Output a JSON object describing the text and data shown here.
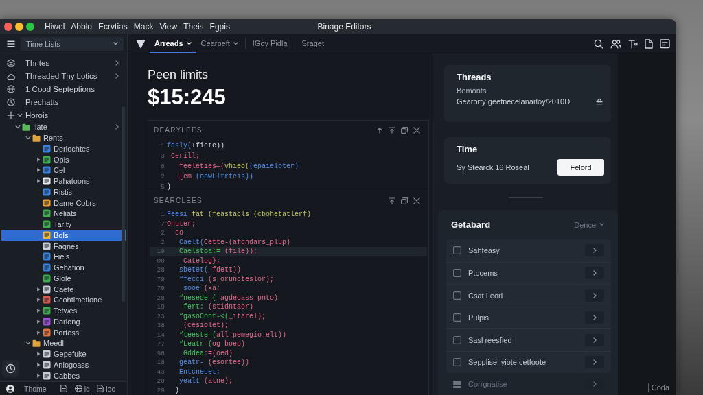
{
  "window": {
    "title": "Binage Editors",
    "menu": [
      "Hiwel",
      "Abblo",
      "Ecrvtias",
      "Mack",
      "View",
      "Theis",
      "Fgpis"
    ]
  },
  "sidebar": {
    "select": {
      "value": "Time Lists"
    },
    "tree": [
      {
        "label": "Thrites",
        "kind": "link",
        "selected": false
      },
      {
        "label": "Threaded Thy Lotics",
        "kind": "link",
        "selected": false
      },
      {
        "label": "1 Cood Septeptions",
        "kind": "item",
        "selected": false
      },
      {
        "label": "Prechatts",
        "kind": "item",
        "selected": false
      },
      {
        "label": "Horois",
        "kind": "item",
        "selected": false,
        "expanded": true,
        "children": [
          {
            "label": "Ilate",
            "kind": "link",
            "selected": false,
            "expanded": true,
            "color": "#5cb85c",
            "children": [
              {
                "label": "Rents",
                "selected": false,
                "expanded": true,
                "color": "#e0a33a",
                "children": [
                  {
                    "label": "Deriochtes",
                    "selected": false,
                    "color": "#3b82e0"
                  },
                  {
                    "label": "Opls",
                    "selected": false,
                    "expanded": false,
                    "color": "#3daa4e"
                  },
                  {
                    "label": "Cel",
                    "selected": false,
                    "expanded": false,
                    "color": "#3b82e0"
                  },
                  {
                    "label": "Pahatoons",
                    "selected": false,
                    "expanded": false,
                    "color": "#e4e6ea"
                  },
                  {
                    "label": "Ristis",
                    "selected": false,
                    "color": "#3b82e0"
                  },
                  {
                    "label": "Dame Cobrs",
                    "selected": false,
                    "color": "#e09a35"
                  },
                  {
                    "label": "Neliats",
                    "selected": false,
                    "color": "#3daa4e"
                  },
                  {
                    "label": "Tarity",
                    "selected": false,
                    "color": "#3daa4e"
                  },
                  {
                    "label": "Bols",
                    "selected": true,
                    "color": "#e8b53a"
                  },
                  {
                    "label": "Faqnes",
                    "selected": false,
                    "color": "#c9cdd3"
                  },
                  {
                    "label": "Fiels",
                    "selected": false,
                    "color": "#3b82e0"
                  },
                  {
                    "label": "Gehation",
                    "selected": false,
                    "color": "#3b82e0"
                  },
                  {
                    "label": "Glole",
                    "selected": false,
                    "color": "#3daa4e"
                  },
                  {
                    "label": "Caefe",
                    "selected": false,
                    "expanded": false,
                    "color": "#c9cdd3"
                  },
                  {
                    "label": "Ccohtimetione",
                    "selected": false,
                    "expanded": false,
                    "color": "#d65a4a"
                  },
                  {
                    "label": "Tetwes",
                    "selected": false,
                    "expanded": false,
                    "color": "#3daa4e"
                  },
                  {
                    "label": "Darlong",
                    "selected": false,
                    "expanded": false,
                    "color": "#9b50d8"
                  },
                  {
                    "label": "Porfess",
                    "selected": false,
                    "expanded": false,
                    "color": "#e0703a"
                  }
                ]
              },
              {
                "label": "Meedl",
                "selected": false,
                "expanded": true,
                "color": "#e0a33a",
                "children": [
                  {
                    "label": "Gepefuke",
                    "selected": false,
                    "expanded": false,
                    "color": "#c9cdd3"
                  },
                  {
                    "label": "Anlogoass",
                    "selected": false,
                    "expanded": false,
                    "color": "#c9cdd3"
                  },
                  {
                    "label": "Cabbes",
                    "selected": false,
                    "expanded": false,
                    "color": "#c9cdd3"
                  }
                ]
              }
            ]
          }
        ]
      }
    ],
    "footer": {
      "user": "Thome",
      "items": [
        "lc",
        "loc"
      ]
    }
  },
  "toolbar": {
    "tabs": [
      {
        "label": "Arreads",
        "selected": true,
        "dropdown": true
      },
      {
        "label": "Cearpeft",
        "selected": false,
        "dropdown": true
      },
      {
        "label": "IGoy Pidla",
        "selected": false,
        "dropdown": false
      },
      {
        "label": "Sraget",
        "selected": false,
        "dropdown": false
      }
    ]
  },
  "main": {
    "title": "Peen limits",
    "amount": "$15:245",
    "panels": [
      {
        "title": "DEARYLEES",
        "tools": [
          {
            "kind": "arrow"
          },
          {
            "kind": "pin"
          },
          {
            "kind": "copy"
          },
          {
            "kind": "close"
          }
        ],
        "lines": [
          {
            "number": "1",
            "highlighted": false,
            "tokens": [
              {
                "text": "fasly(",
                "kind": "fn"
              },
              {
                "text": "Ifiete))",
                "kind": "plain"
              }
            ]
          },
          {
            "number": "3",
            "highlighted": false,
            "tokens": [
              {
                "text": " Cerill;",
                "kind": "kw"
              }
            ]
          },
          {
            "number": "8",
            "highlighted": false,
            "tokens": [
              {
                "text": "   feeleties—(",
                "kind": "kw"
              },
              {
                "text": "vhieo(",
                "kind": "str"
              },
              {
                "text": "(epaieloter)",
                "kind": "fn"
              }
            ]
          },
          {
            "number": "2",
            "highlighted": false,
            "tokens": [
              {
                "text": "   [em ",
                "kind": "kw"
              },
              {
                "text": "(oowLltrteis))",
                "kind": "fn"
              }
            ]
          },
          {
            "number": "5",
            "highlighted": false,
            "tokens": [
              {
                "text": ")",
                "kind": "plain"
              }
            ]
          }
        ]
      },
      {
        "title": "SEARCLEES",
        "tools": [
          {
            "kind": "pin"
          },
          {
            "kind": "copy"
          },
          {
            "kind": "close"
          }
        ],
        "lines": [
          {
            "number": "1",
            "highlighted": false,
            "tokens": [
              {
                "text": "Feesi",
                "kind": "fn"
              },
              {
                "text": " fat (feastacls (cbohetatlerf)",
                "kind": "str"
              }
            ]
          },
          {
            "number": "7",
            "highlighted": false,
            "tokens": [
              {
                "text": "Onuter;",
                "kind": "kw"
              }
            ]
          },
          {
            "number": "2",
            "highlighted": false,
            "tokens": [
              {
                "text": "  co",
                "kind": "kw"
              }
            ]
          },
          {
            "number": "2",
            "highlighted": false,
            "tokens": [
              {
                "text": "   Caelt(",
                "kind": "fn"
              },
              {
                "text": "Cette-(afqndars_plup)",
                "kind": "kw"
              }
            ]
          },
          {
            "number": "19",
            "highlighted": true,
            "tokens": [
              {
                "text": "   Caelstoa:=",
                "kind": "var"
              },
              {
                "text": " (file));",
                "kind": "kw"
              }
            ]
          },
          {
            "number": "00",
            "highlighted": false,
            "tokens": [
              {
                "text": "    Catelog};",
                "kind": "kw"
              }
            ]
          },
          {
            "number": "28",
            "highlighted": false,
            "tokens": [
              {
                "text": "   sbetet(",
                "kind": "fn"
              },
              {
                "text": "_fdett))",
                "kind": "kw"
              }
            ]
          },
          {
            "number": "79",
            "highlighted": false,
            "tokens": [
              {
                "text": "   “fecci",
                "kind": "fn"
              },
              {
                "text": " (s oruncteslor);",
                "kind": "kw"
              }
            ]
          },
          {
            "number": "79",
            "highlighted": false,
            "tokens": [
              {
                "text": "    sooe",
                "kind": "fn"
              },
              {
                "text": " (xa;",
                "kind": "kw"
              }
            ]
          },
          {
            "number": "28",
            "highlighted": false,
            "tokens": [
              {
                "text": "   “nesede-(",
                "kind": "var"
              },
              {
                "text": "_agdecass_pnto)",
                "kind": "kw"
              }
            ]
          },
          {
            "number": "19",
            "highlighted": false,
            "tokens": [
              {
                "text": "    fert: ",
                "kind": "var"
              },
              {
                "text": "(stidntaor)",
                "kind": "kw"
              }
            ]
          },
          {
            "number": "23",
            "highlighted": false,
            "tokens": [
              {
                "text": "   “gasoCont-<(",
                "kind": "var"
              },
              {
                "text": "_itarel);",
                "kind": "kw"
              }
            ]
          },
          {
            "number": "38",
            "highlighted": false,
            "tokens": [
              {
                "text": "    (cesiolet);",
                "kind": "kw"
              }
            ]
          },
          {
            "number": "14",
            "highlighted": false,
            "tokens": [
              {
                "text": "   “teeste-(",
                "kind": "var"
              },
              {
                "text": "all_pemegio_elt))",
                "kind": "kw"
              }
            ]
          },
          {
            "number": "77",
            "highlighted": false,
            "tokens": [
              {
                "text": "   “Leatr-(",
                "kind": "var"
              },
              {
                "text": "og boep)",
                "kind": "kw"
              }
            ]
          },
          {
            "number": "98",
            "highlighted": false,
            "tokens": [
              {
                "text": "    Gddea",
                "kind": "var"
              },
              {
                "text": ":=(oed)",
                "kind": "kw"
              }
            ]
          },
          {
            "number": "18",
            "highlighted": false,
            "tokens": [
              {
                "text": "   geatr-",
                "kind": "fn"
              },
              {
                "text": " (esortee))",
                "kind": "kw"
              }
            ]
          },
          {
            "number": "43",
            "highlighted": false,
            "tokens": [
              {
                "text": "   Entcnecet;",
                "kind": "fn"
              }
            ]
          },
          {
            "number": "29",
            "highlighted": false,
            "tokens": [
              {
                "text": "   yealt",
                "kind": "fn"
              },
              {
                "text": " (atne);",
                "kind": "kw"
              }
            ]
          },
          {
            "number": "29",
            "highlighted": false,
            "tokens": [
              {
                "text": "  )",
                "kind": "plain"
              }
            ]
          }
        ]
      }
    ]
  },
  "side": {
    "cards": [
      {
        "kind": "info",
        "title": "Threads",
        "subtitle": "Bemonts",
        "text": "Gearorty geetnecelanarloy/2010D."
      },
      {
        "kind": "action",
        "title": "Time",
        "text": "Sy Stearck 16 Roseal",
        "button": "Felord"
      }
    ],
    "board": {
      "title": "Getabard",
      "filter": "Dence",
      "rows": [
        {
          "label": "Sahfeasy",
          "kind": "checkbox",
          "checked": false,
          "disabled": false
        },
        {
          "label": "Ptocems",
          "kind": "checkbox",
          "checked": false,
          "disabled": false
        },
        {
          "label": "Csat Leorl",
          "kind": "checkbox",
          "checked": false,
          "disabled": false
        },
        {
          "label": "Pulpis",
          "kind": "checkbox",
          "checked": false,
          "disabled": false
        },
        {
          "label": "Sasl reesfied",
          "kind": "checkbox",
          "checked": false,
          "disabled": false
        },
        {
          "label": "Sepplisel yiote cetfoote",
          "kind": "checkbox",
          "checked": false,
          "disabled": false
        },
        {
          "label": "Corrgnatise",
          "kind": "stack",
          "disabled": true
        }
      ]
    }
  },
  "status": "Coda"
}
